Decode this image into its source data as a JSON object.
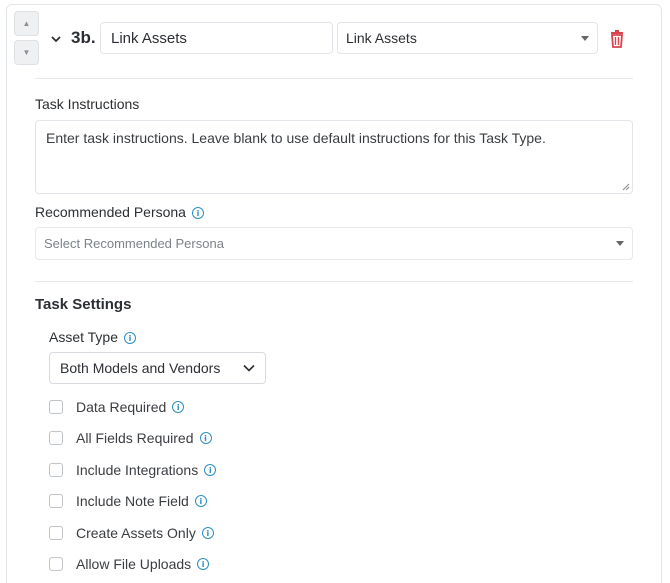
{
  "task": {
    "step_number": "3b.",
    "name_value": "Link Assets",
    "type_value": "Link Assets"
  },
  "instructions": {
    "label": "Task Instructions",
    "placeholder": "Enter task instructions. Leave blank to use default instructions for this Task Type."
  },
  "persona": {
    "label": "Recommended Persona",
    "placeholder": "Select Recommended Persona"
  },
  "settings": {
    "title": "Task Settings",
    "asset_type_label": "Asset Type",
    "asset_type_value": "Both Models and Vendors",
    "options": [
      {
        "label": "Data Required",
        "checked": false
      },
      {
        "label": "All Fields Required",
        "checked": false
      },
      {
        "label": "Include Integrations",
        "checked": false
      },
      {
        "label": "Include Note Field",
        "checked": false
      },
      {
        "label": "Create Assets Only",
        "checked": false
      },
      {
        "label": "Allow File Uploads",
        "checked": false
      }
    ]
  },
  "colors": {
    "info_icon": "#2d8fc2",
    "delete_icon": "#d9434f"
  }
}
